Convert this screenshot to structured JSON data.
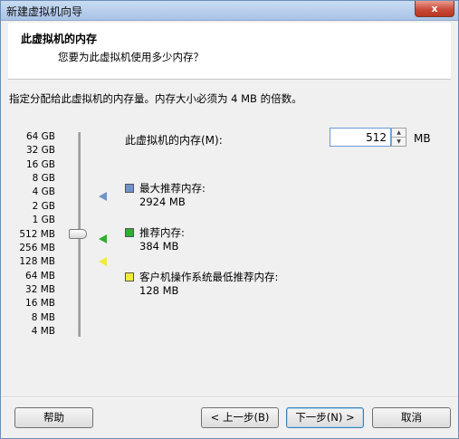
{
  "window": {
    "title": "新建虚拟机向导",
    "close_glyph": "x"
  },
  "header": {
    "title": "此虚拟机的内存",
    "subtitle": "您要为此虚拟机使用多少内存？"
  },
  "instruction": "指定分配给此虚拟机的内存量。内存大小必须为 4 MB 的倍数。",
  "memory": {
    "label": "此虚拟机的内存(M):",
    "value": "512",
    "unit": "MB"
  },
  "scale_labels": [
    "64 GB",
    "32 GB",
    "16 GB",
    "8 GB",
    "4 GB",
    "2 GB",
    "1 GB",
    "512 MB",
    "256 MB",
    "128 MB",
    "64 MB",
    "32 MB",
    "16 MB",
    "8 MB",
    "4 MB"
  ],
  "slider": {
    "selected": "512 MB"
  },
  "legend": [
    {
      "label": "最大推荐内存:",
      "value": "2924 MB",
      "color": "#6f93c4"
    },
    {
      "label": "推荐内存:",
      "value": "384 MB",
      "color": "#2fae2f"
    },
    {
      "label": "客户机操作系统最低推荐内存:",
      "value": "128 MB",
      "color": "#f2ea3c"
    }
  ],
  "buttons": {
    "help": "帮助",
    "back": "< 上一步(B)",
    "next": "下一步(N) >",
    "cancel": "取消"
  }
}
